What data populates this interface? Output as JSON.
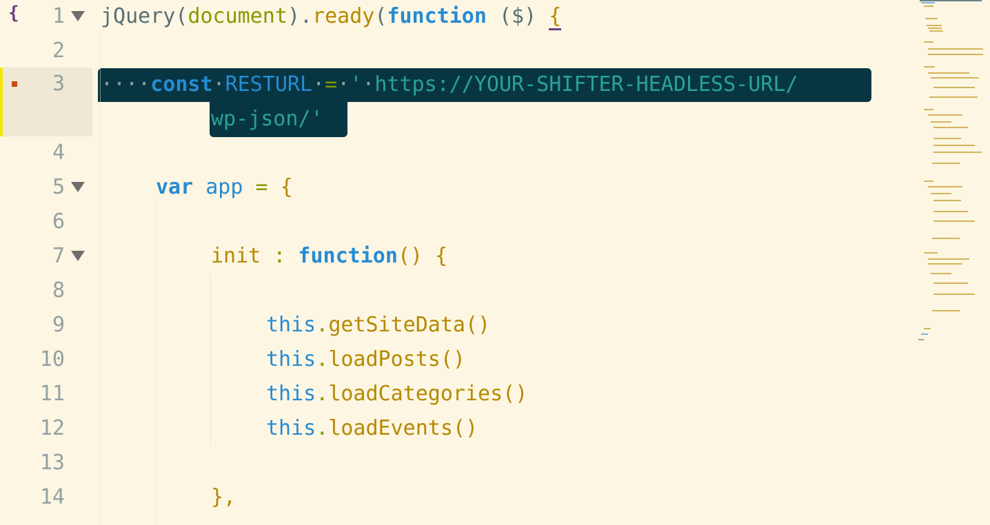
{
  "editor": {
    "gutter_marker": "{",
    "line_numbers": [
      "1",
      "2",
      "3",
      "4",
      "5",
      "6",
      "7",
      "8",
      "9",
      "10",
      "11",
      "12",
      "13",
      "14"
    ],
    "line1": {
      "p1": "jQuery(",
      "p2": "document",
      "p3": ").",
      "p4": "ready",
      "p5": "(",
      "p6": "function",
      "p7": " ($) ",
      "p8": "{"
    },
    "line3": {
      "ws1": "····",
      "kw": "const",
      "ws2": "·",
      "name": "RESTURL",
      "ws3": "·",
      "eq": "=",
      "ws4": "·",
      "q": "'",
      "ws5": "·",
      "url1": "https://YOUR-SHIFTER-HEADLESS-URL/",
      "url2": "wp-json/'"
    },
    "line5": {
      "kw": "var",
      "name": " app ",
      "eq": "=",
      "brace": " {"
    },
    "line7": {
      "name": "init ",
      "colon": ":",
      "kw": " function",
      "rest": "() {"
    },
    "line9": {
      "this": "this",
      "dot": ".",
      "call": "getSiteData()"
    },
    "line10": {
      "this": "this",
      "dot": ".",
      "call": "loadPosts()"
    },
    "line11": {
      "this": "this",
      "dot": ".",
      "call": "loadCategories()"
    },
    "line12": {
      "this": "this",
      "dot": ".",
      "call": "loadEvents()"
    },
    "line14": {
      "text": "},"
    }
  },
  "colors": {
    "background": "#fdf6e3",
    "selection": "#073642",
    "keyword": "#268bd2",
    "function": "#b58900",
    "string": "#2aa198",
    "line_number": "#93a1a1",
    "modified_bar": "#f5e50a",
    "modified_dot": "#cb4b16"
  },
  "icons": {
    "fold": "fold-triangle-icon",
    "brace_marker": "brace-marker-icon",
    "modified": "modified-line-icon"
  }
}
